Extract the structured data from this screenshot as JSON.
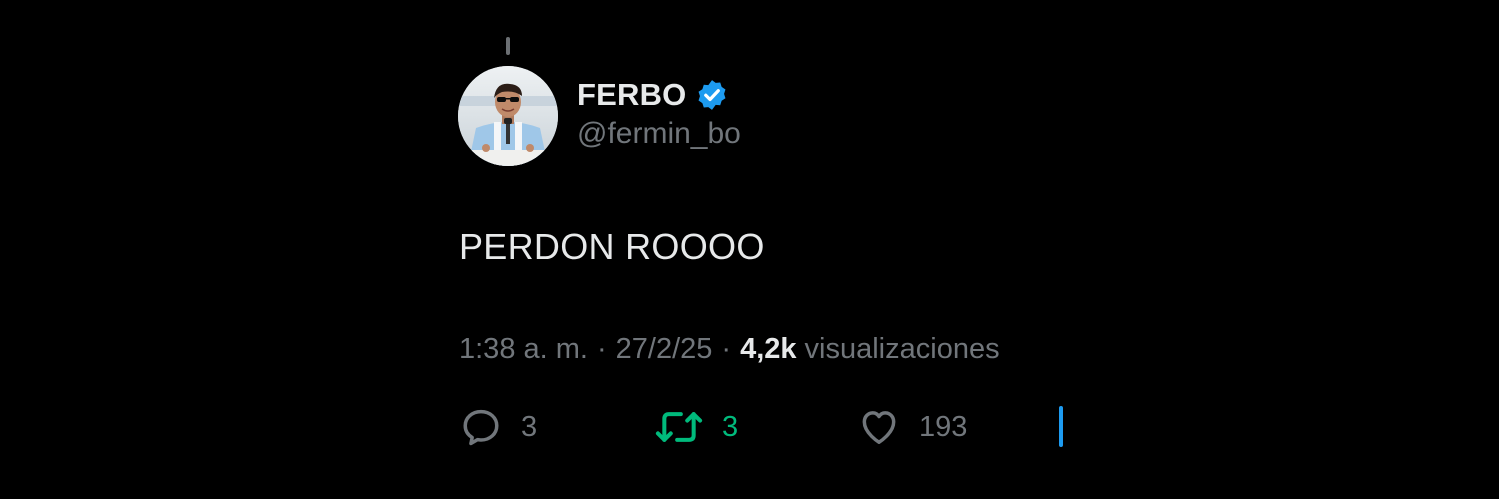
{
  "tweet": {
    "author": {
      "display_name": "FERBO",
      "handle": "@fermin_bo",
      "verified": true
    },
    "text": "PERDON ROOOO",
    "meta": {
      "time": "1:38 a. m.",
      "separator": "·",
      "date": "27/2/25",
      "views_count": "4,2k",
      "views_label": "visualizaciones"
    },
    "actions": {
      "replies": "3",
      "retweets": "3",
      "likes": "193"
    }
  },
  "colors": {
    "background": "#000000",
    "primary_text": "#e7e9ea",
    "secondary_text": "#71767b",
    "verified_blue": "#1d9bf0",
    "retweet_green": "#00ba7c"
  },
  "icons": {
    "verified": "verified-badge-icon",
    "reply": "reply-bubble-icon",
    "retweet": "retweet-arrows-icon",
    "like": "heart-icon"
  }
}
